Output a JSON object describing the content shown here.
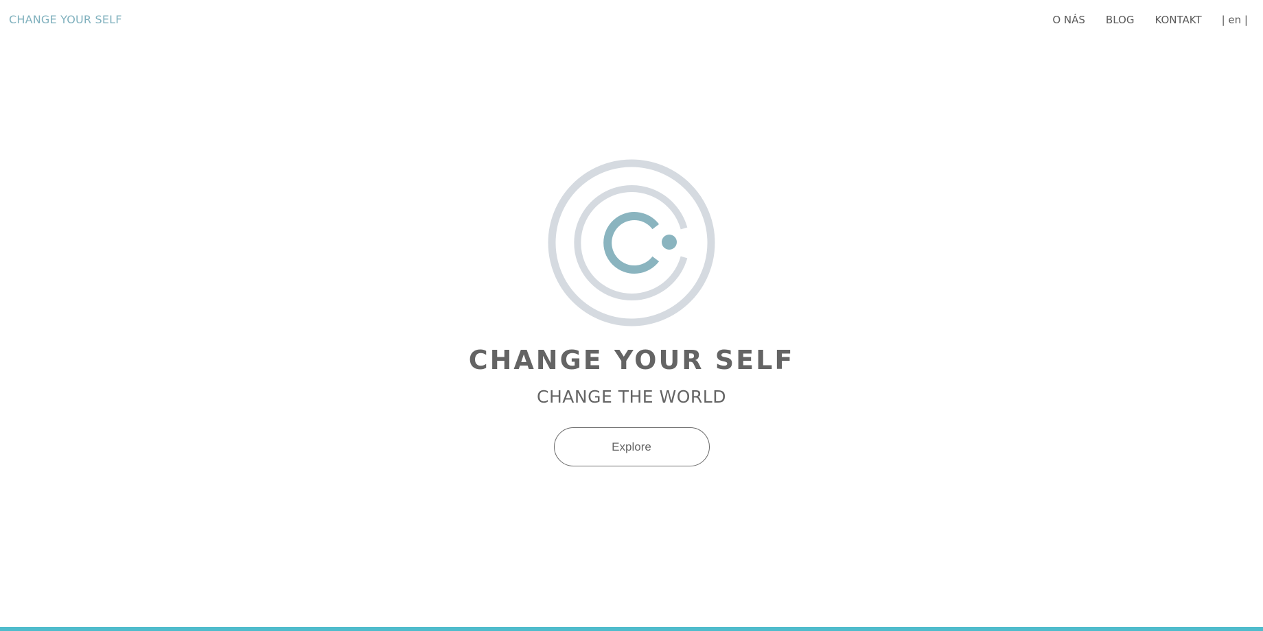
{
  "brand": {
    "name": "CHANGE YOUR SELF"
  },
  "nav": {
    "items": [
      {
        "label": "O NÁS"
      },
      {
        "label": "BLOG"
      },
      {
        "label": "KONTAKT"
      }
    ],
    "language": "| en |"
  },
  "hero": {
    "logo_icon": "concentric-circles-c-logo",
    "title": "CHANGE YOUR SELF",
    "subtitle": "CHANGE THE WORLD",
    "button_label": "Explore"
  },
  "colors": {
    "brand_teal": "#7fb0bd",
    "logo_teal": "#8ab4bf",
    "logo_gray": "#d5dae0",
    "text_gray": "#646464",
    "nav_text": "#5a5a5a",
    "button_border": "#6a6a6a",
    "bottom_bar": "#4fbccc"
  }
}
